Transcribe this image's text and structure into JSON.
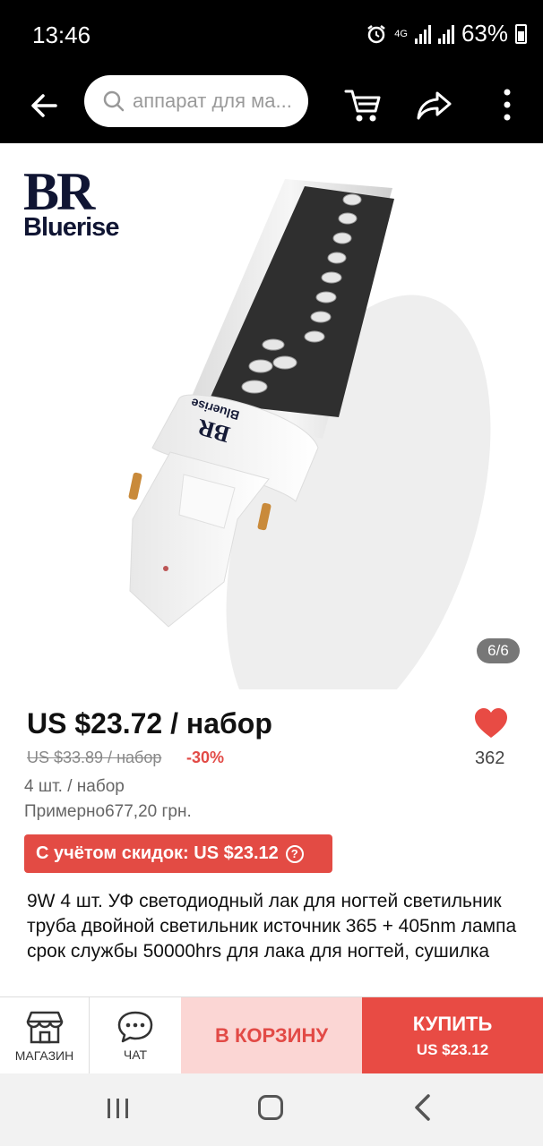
{
  "status_bar": {
    "time": "13:46",
    "network": "4G",
    "battery": "63%"
  },
  "header": {
    "search_placeholder": "аппарат для ма...",
    "icons": [
      "back-arrow-icon",
      "search-icon",
      "cart-icon",
      "share-icon",
      "more-icon"
    ]
  },
  "gallery": {
    "counter": "6/6",
    "brand_logo": {
      "monogram": "BR",
      "name": "Bluerise"
    }
  },
  "product": {
    "price": "US $23.72 / набор",
    "old_price": "US $33.89 / набор",
    "discount": "-30%",
    "quantity": "4 шт. / набор",
    "approx": "Примерно677,20 грн.",
    "likes": "362",
    "coupon": "С учётом скидок: US $23.12",
    "coupon_icon": "?",
    "title": "9W 4 шт. УФ светодиодный лак для ногтей светильник труба двойной светильник источник 365 + 405nm лампа срок службы 50000hrs для лака для ногтей, сушилка"
  },
  "actions": {
    "shop_label": "МАГАЗИН",
    "chat_label": "ЧАТ",
    "add_to_cart": "В КОРЗИНУ",
    "buy_label": "КУПИТЬ",
    "buy_price": "US $23.12"
  },
  "colors": {
    "accent": "#e84b44",
    "cart_bg": "#fbd6d4",
    "header_bg": "#000000"
  }
}
